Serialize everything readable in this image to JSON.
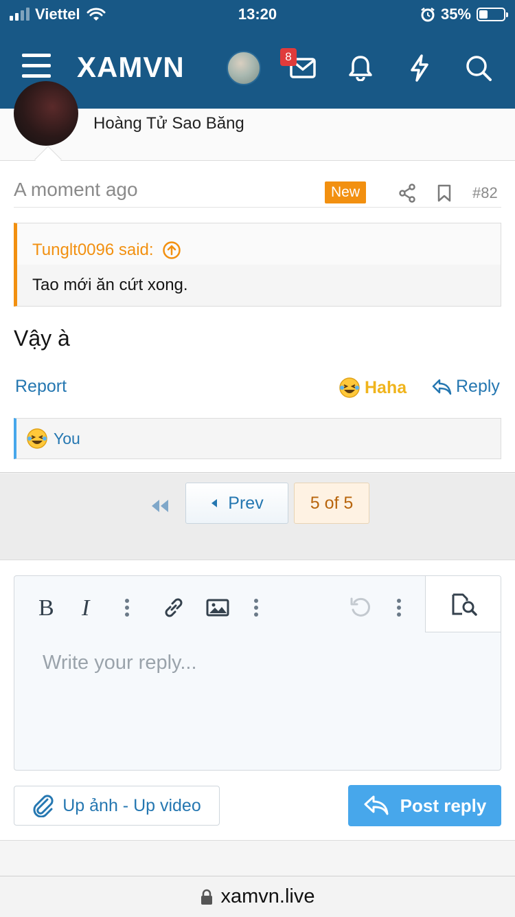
{
  "status_bar": {
    "carrier": "Viettel",
    "time": "13:20",
    "battery": "35%",
    "battery_level": 0.35
  },
  "header": {
    "logo": "XAMVN",
    "notification_count": "8",
    "icons": [
      "menu-icon",
      "avatar",
      "inbox-icon",
      "bell-icon",
      "bolt-icon",
      "search-icon"
    ]
  },
  "author": {
    "name": "Hoàng Tử Sao Băng"
  },
  "post": {
    "time": "A moment ago",
    "new_badge": "New",
    "number": "#82",
    "quote": {
      "author_line": "Tunglt0096 said:",
      "text": "Tao mới ăn cứt xong."
    },
    "text": "Vậy à",
    "actions": {
      "report": "Report",
      "reaction": "Haha",
      "reply": "Reply"
    },
    "reactions_by": "You"
  },
  "pagination": {
    "prev_label": "Prev",
    "current": "5 of 5"
  },
  "editor": {
    "placeholder": "Write your reply..."
  },
  "buttons": {
    "upload": "Up ảnh - Up video",
    "post_reply": "Post reply"
  },
  "url_bar": {
    "domain": "xamvn.live"
  },
  "colors": {
    "header": "#185886",
    "accent_orange": "#f29010",
    "link_blue": "#2577b1",
    "button_blue": "#47a7eb",
    "haha_yellow": "#f0b41c"
  }
}
